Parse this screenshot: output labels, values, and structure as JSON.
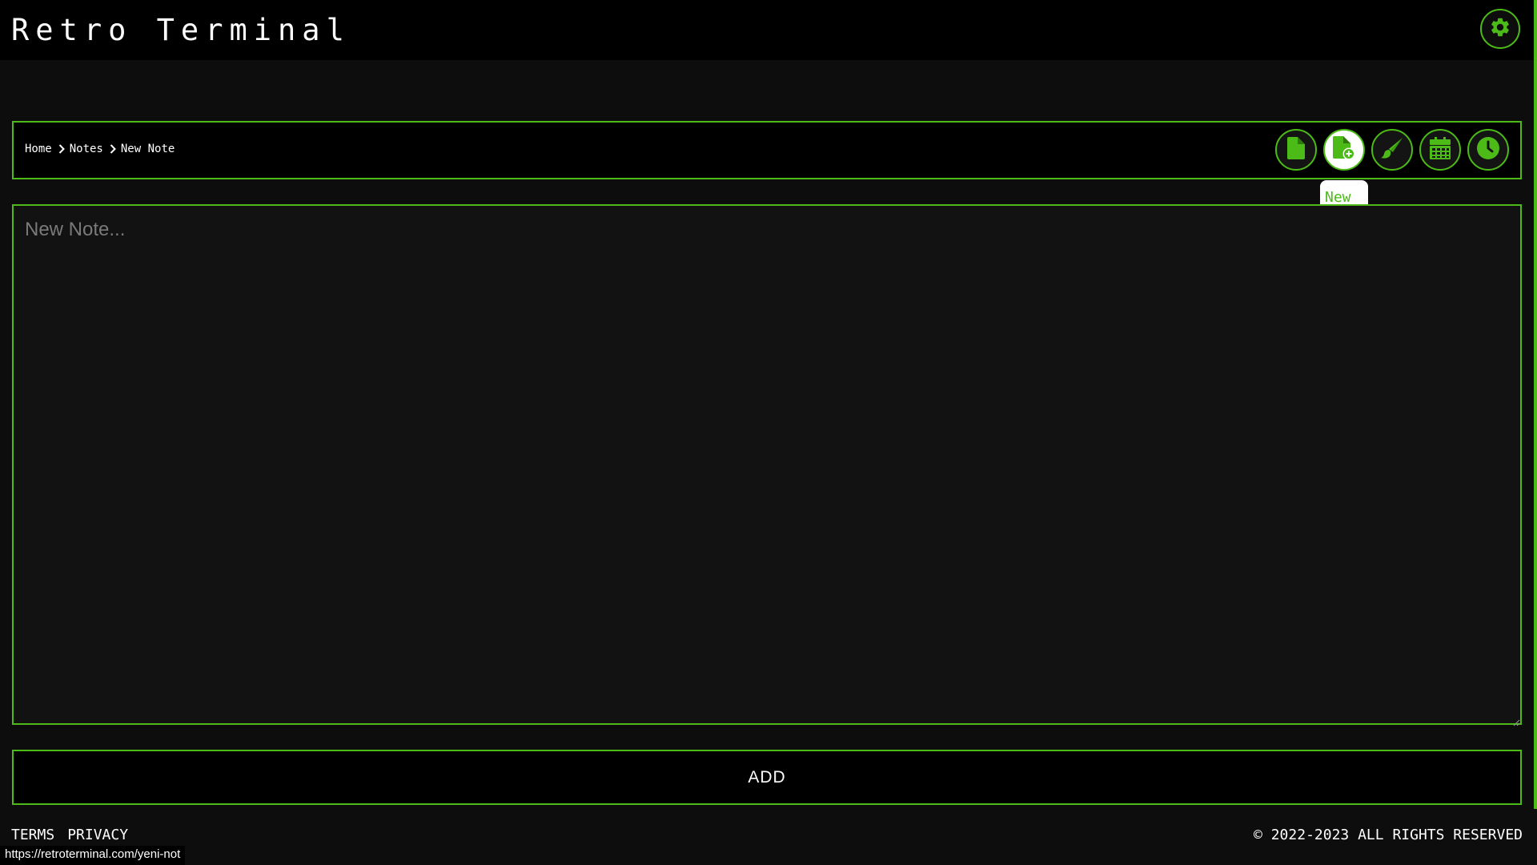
{
  "app": {
    "title": "Retro Terminal",
    "accent_color": "#4cbb17",
    "background_color": "#0d0d0d"
  },
  "header": {
    "settings_icon": "gear-icon"
  },
  "breadcrumb": {
    "items": [
      "Home",
      "Notes",
      "New Note"
    ],
    "separator_icon": "chevron-right-icon"
  },
  "toolbar": {
    "buttons": [
      {
        "icon": "document-icon",
        "active": false
      },
      {
        "icon": "document-plus-icon",
        "active": true
      },
      {
        "icon": "paintbrush-icon",
        "active": false
      },
      {
        "icon": "calendar-icon",
        "active": false
      },
      {
        "icon": "clock-icon",
        "active": false
      }
    ],
    "tooltip": "New Note"
  },
  "editor": {
    "value": "",
    "placeholder": "New Note..."
  },
  "actions": {
    "add_label": "ADD"
  },
  "footer": {
    "terms": "TERMS",
    "privacy": "PRIVACY",
    "copyright": "© 2022-2023 ALL RIGHTS RESERVED"
  },
  "status_bar": {
    "url": "https://retroterminal.com/yeni-not"
  }
}
